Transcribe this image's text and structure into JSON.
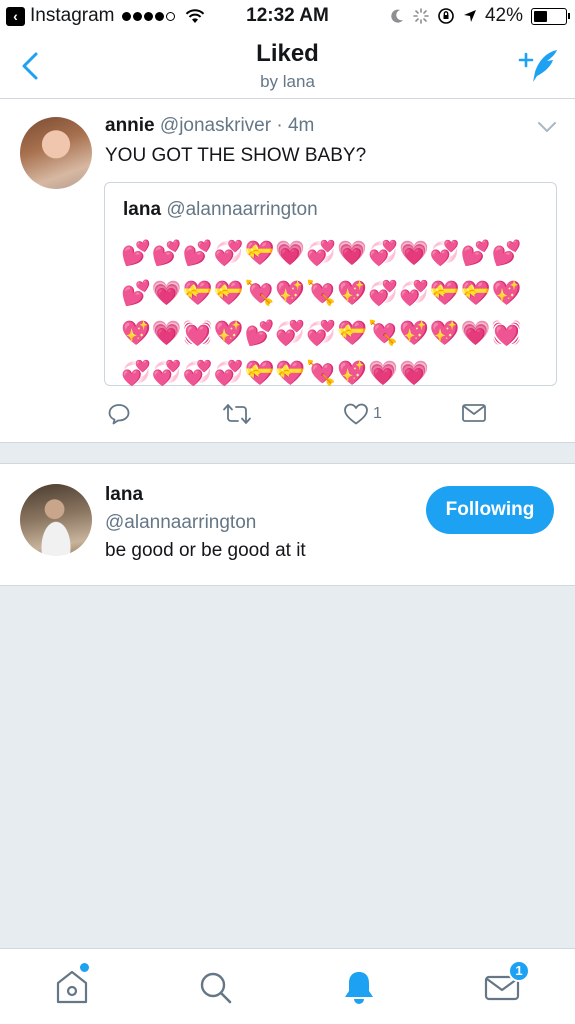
{
  "status_bar": {
    "back_app": "Instagram",
    "time": "12:32 AM",
    "battery": "42%",
    "battery_level": 0.42
  },
  "nav": {
    "title": "Liked",
    "subtitle": "by lana",
    "back_icon": "chevron-left-icon",
    "compose_icon": "compose-icon"
  },
  "tweet": {
    "name": "annie",
    "handle": "@jonaskriver",
    "dot": "·",
    "time": "4m",
    "text": "YOU GOT THE SHOW BABY?",
    "quote": {
      "name": "lana",
      "handle": "@alannaarrington",
      "text": "💕💕💕💞💝💗💞💗💞💗💞💕💕💕💗💝💝💘💖💘💖💞💞💝💝💖💖💗💓💖💕💞💞💝💘💖💖💗💓💞💞💞💞💝💝💘💖💗💗"
    },
    "actions": {
      "like_count": "1"
    }
  },
  "user": {
    "name": "lana",
    "handle": "@alannaarrington",
    "bio": "be good or be good at it",
    "follow_label": "Following"
  },
  "tab_bar": {
    "messages_badge": "1",
    "active_color": "#1da1f2"
  }
}
